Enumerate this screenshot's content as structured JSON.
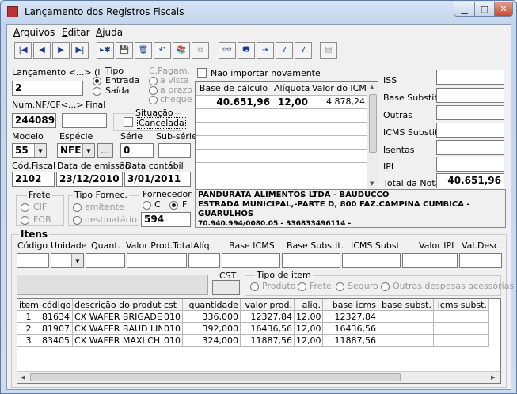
{
  "window": {
    "title": "Lançamento dos Registros Fiscais",
    "min": "▁",
    "max": "□",
    "close": "✕"
  },
  "menu": [
    {
      "label": "Arquivos",
      "u": "A",
      "rest": "rquivos"
    },
    {
      "label": "Editar",
      "u": "E",
      "rest": "ditar"
    },
    {
      "label": "Ajuda",
      "u": "A",
      "rest": "juda"
    }
  ],
  "toolbar": {
    "icons": [
      "first-icon",
      "prev-icon",
      "next-icon",
      "last-icon",
      "new-record-icon",
      "save-icon",
      "delete-icon",
      "undo-icon",
      "books-icon",
      "copy-icon",
      "binoculars-icon",
      "print-icon",
      "exit-icon",
      "help-icon",
      "context-help-icon",
      "notes-icon"
    ],
    "glyphs": [
      "|◀",
      "◀",
      "▶",
      "▶|",
      "▸✱",
      "💾",
      "🗑",
      "↶",
      "📚",
      "⧉",
      "👓",
      "🖶",
      "⇥",
      "?",
      "?",
      "▤"
    ]
  },
  "form": {
    "lancamento_label": "Lançamento <...> (i",
    "lancamento_value": "2",
    "tipo_label": "Tipo",
    "tipo_entrada": "Entrada",
    "tipo_saida": "Saída",
    "cpagam_label": "C.Pagam.",
    "cpagam_vista": "a vista",
    "cpagam_prazo": "a prazo",
    "cpagam_cheque": "cheque",
    "nao_importar": "Não importar novamente",
    "numnf_label": "Num.NF/CF<...>",
    "numnf_value": "244089",
    "final_label": "Final",
    "final_value": "",
    "situacao_label": "Situação",
    "cancelada": "Cancelada",
    "modelo_label": "Modelo",
    "modelo_value": "55",
    "especie_label": "Espécie",
    "especie_value": "NFE",
    "especie_btn": "...",
    "serie_label": "Série",
    "serie_value": "0",
    "subserie_label": "Sub-série",
    "subserie_value": "",
    "codfiscal_label": "Cód.Fiscal",
    "codfiscal_value": "2102",
    "emissao_label": "Data de emissão",
    "emissao_value": "23/12/2010",
    "contabil_label": "Data contábil",
    "contabil_value": "3/01/2011",
    "frete_label": "Frete",
    "frete_cif": "CIF",
    "frete_fob": "FOB",
    "tipofornec_label": "Tipo Fornec.",
    "tipofornec_emitente": "emitente",
    "tipofornec_dest": "destinatário",
    "fornecedor_label": "Fornecedor",
    "fornecedor_c": "C",
    "fornecedor_f": "F",
    "fornecedor_code": "594",
    "fornecedor_name": "PANDURATA ALIMENTOS LTDA - BAUDUCCO",
    "fornecedor_addr1": "ESTRADA MUNICIPAL,-PARTE D,  800 FAZ.CAMPINA CUMBICA -",
    "fornecedor_addr2": "GUARULHOS",
    "fornecedor_cnpj": "70.940.994/0080.05  -  336833496114 -"
  },
  "tax_grid": {
    "headers": [
      "Base de cálculo",
      "Alíquota",
      "Valor do ICMS"
    ],
    "row": [
      "40.651,96",
      "12,00",
      "4.878,24"
    ]
  },
  "totals": {
    "iss_label": "ISS",
    "iss_value": "",
    "basesubst_label": "Base Substit.",
    "basesubst_value": "",
    "outras_label": "Outras",
    "outras_value": "",
    "icmssubst_label": "ICMS Substit.",
    "icmssubst_value": "",
    "isentas_label": "Isentas",
    "isentas_value": "",
    "ipi_label": "IPI",
    "ipi_value": "",
    "total_label": "Total da Nota",
    "total_value": "40.651,96"
  },
  "itens": {
    "title": "Itens",
    "headers": [
      "Código",
      "Unidade",
      "Quant.",
      "Valor Prod.Total",
      "Alíq.",
      "Base ICMS",
      "Base Substit.",
      "ICMS Subst.",
      "Valor IPI",
      "Val.Desc."
    ],
    "cst_label": "CST",
    "tipo_item_label": "Tipo de item",
    "tipo_produto": "Produto",
    "tipo_frete": "Frete",
    "tipo_seguro": "Seguro",
    "tipo_outras": "Outras despesas acessórias"
  },
  "items_grid": {
    "headers": [
      "item",
      "código",
      "descrição do produto",
      "cst",
      "quantidade",
      "valor prod.",
      "aliq.",
      "base icms",
      "base subst.",
      "icms subst."
    ],
    "rows": [
      [
        "1",
        "81634",
        "CX  WAFER BRIGADE",
        "010",
        "336,000",
        "12327,84",
        "12,00",
        "12327,84",
        "",
        ""
      ],
      [
        "2",
        "81907",
        "CX  WAFER BAUD LIN",
        "010",
        "392,000",
        "16436,56",
        "12,00",
        "16436,56",
        "",
        ""
      ],
      [
        "3",
        "83405",
        "CX  WAFER MAXI CH",
        "010",
        "324,000",
        "11887,56",
        "12,00",
        "11887,56",
        "",
        ""
      ]
    ]
  }
}
